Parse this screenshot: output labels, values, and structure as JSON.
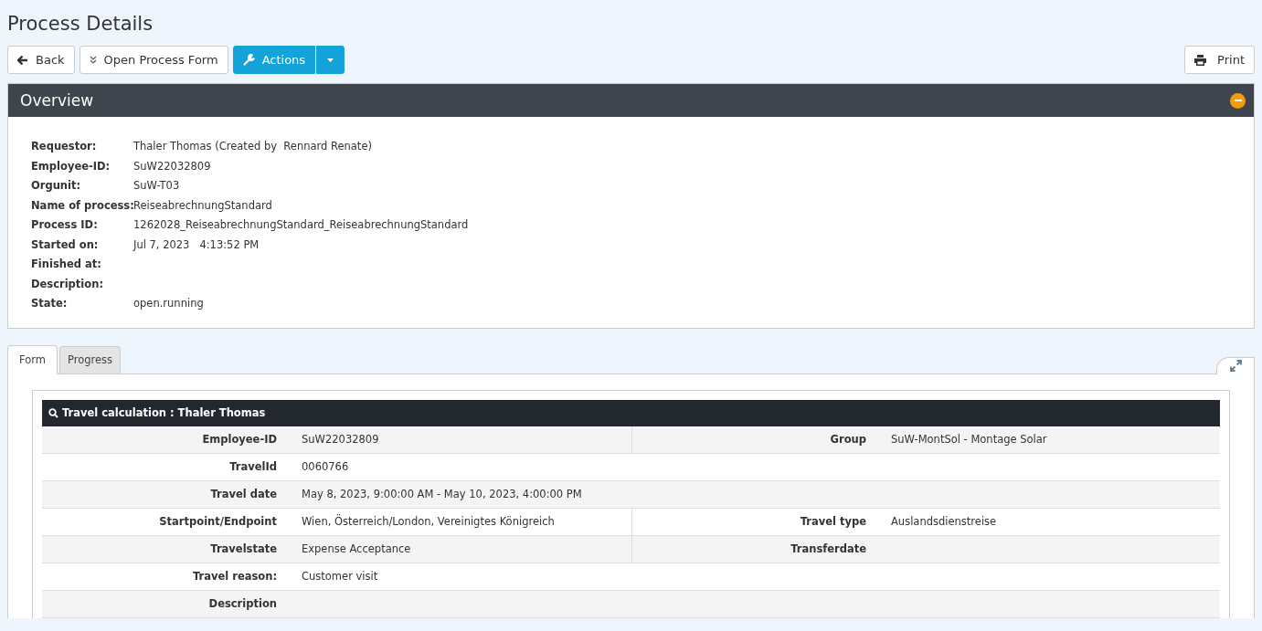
{
  "page": {
    "title": "Process Details"
  },
  "toolbar": {
    "back": "Back",
    "open_form": "Open Process Form",
    "actions": "Actions",
    "print": "Print"
  },
  "overview": {
    "title": "Overview",
    "expanded": true,
    "fields": [
      {
        "label": "Requestor:",
        "value": "Thaler Thomas (Created by  Rennard Renate)"
      },
      {
        "label": "Employee-ID:",
        "value": "SuW22032809"
      },
      {
        "label": "Orgunit:",
        "value": "SuW-T03"
      },
      {
        "label": "Name of process:",
        "value": "ReiseabrechnungStandard"
      },
      {
        "label": "Process ID:",
        "value": "1262028_ReiseabrechnungStandard_ReiseabrechnungStandard"
      },
      {
        "label": "Started on:",
        "value": "Jul 7, 2023   4:13:52 PM"
      },
      {
        "label": "Finished at:"
      },
      {
        "label": "Description:"
      },
      {
        "label": "State:",
        "value": "open.running"
      }
    ]
  },
  "tabs": [
    {
      "label": "Form",
      "selected": true
    },
    {
      "label": "Progress",
      "selected": false
    }
  ],
  "form": {
    "title": "Travel calculation : Thaler Thomas",
    "rows": [
      {
        "cells": [
          {
            "label": "Employee-ID",
            "value": "SuW22032809"
          },
          {
            "label": "Group",
            "value": "SuW-MontSol - Montage Solar"
          }
        ]
      },
      {
        "cells": [
          {
            "label": "TravelId",
            "value": "0060766"
          }
        ]
      },
      {
        "cells": [
          {
            "label": "Travel date",
            "value": "May 8, 2023, 9:00:00 AM - May 10, 2023, 4:00:00 PM"
          }
        ]
      },
      {
        "cells": [
          {
            "label": "Startpoint/Endpoint",
            "value": "Wien, Österreich/London, Vereinigtes Königreich"
          },
          {
            "label": "Travel type",
            "value": "Auslandsdienstreise"
          }
        ]
      },
      {
        "cells": [
          {
            "label": "Travelstate",
            "value": "Expense Acceptance"
          },
          {
            "label": "Transferdate"
          }
        ]
      },
      {
        "cells": [
          {
            "label": "Travel reason:",
            "value": "Customer visit"
          }
        ]
      },
      {
        "cells": [
          {
            "label": "Description"
          }
        ]
      }
    ]
  }
}
